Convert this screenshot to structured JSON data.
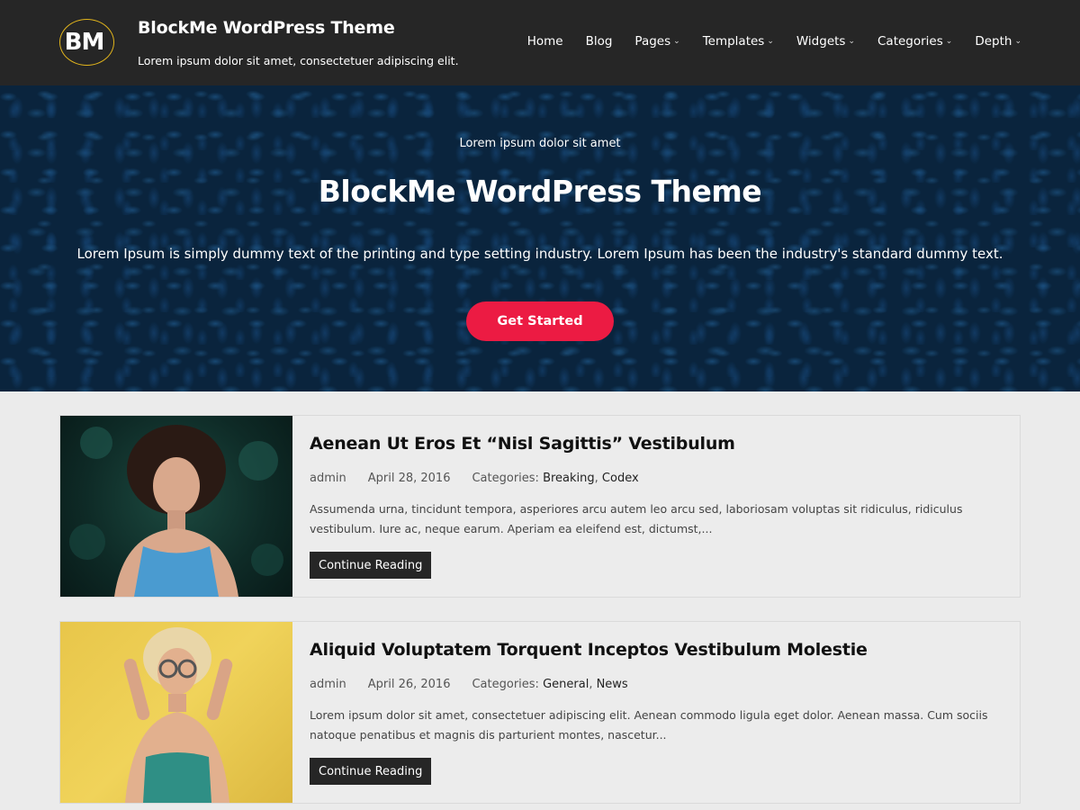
{
  "header": {
    "logo_text": "BM",
    "site_title": "BlockMe WordPress Theme",
    "tagline": "Lorem ipsum dolor sit amet, consectetuer adipiscing elit.",
    "nav": [
      {
        "label": "Home",
        "has_dropdown": false
      },
      {
        "label": "Blog",
        "has_dropdown": false
      },
      {
        "label": "Pages",
        "has_dropdown": true
      },
      {
        "label": "Templates",
        "has_dropdown": true
      },
      {
        "label": "Widgets",
        "has_dropdown": true
      },
      {
        "label": "Categories",
        "has_dropdown": true
      },
      {
        "label": "Depth",
        "has_dropdown": true
      }
    ]
  },
  "hero": {
    "kicker": "Lorem ipsum dolor sit amet",
    "title": "BlockMe WordPress Theme",
    "text": "Lorem Ipsum is simply dummy text of the printing and type setting industry. Lorem Ipsum has been the industry's standard dummy text.",
    "button_label": "Get Started"
  },
  "posts": [
    {
      "title": "Aenean Ut Eros Et “Nisl Sagittis” Vestibulum",
      "author": "admin",
      "date": "April 28, 2016",
      "categories_label": "Categories:",
      "categories": [
        "Breaking",
        "Codex"
      ],
      "excerpt": "Assumenda urna, tincidunt tempora, asperiores arcu autem leo arcu sed, laboriosam voluptas sit ridiculus, ridiculus vestibulum. Iure ac, neque earum. Aperiam ea eleifend est, dictumst,...",
      "read_more": "Continue Reading"
    },
    {
      "title": "Aliquid Voluptatem Torquent Inceptos Vestibulum Molestie",
      "author": "admin",
      "date": "April 26, 2016",
      "categories_label": "Categories:",
      "categories": [
        "General",
        "News"
      ],
      "excerpt": "Lorem ipsum dolor sit amet, consectetuer adipiscing elit. Aenean commodo ligula eget dolor. Aenean massa. Cum sociis natoque penatibus et magnis dis parturient montes, nascetur...",
      "read_more": "Continue Reading"
    }
  ],
  "colors": {
    "header_bg": "#262626",
    "accent_button": "#ec1b43",
    "logo_ring": "#e1b41c",
    "hero_bg": "#0c2a45",
    "page_bg": "#ebebeb"
  }
}
